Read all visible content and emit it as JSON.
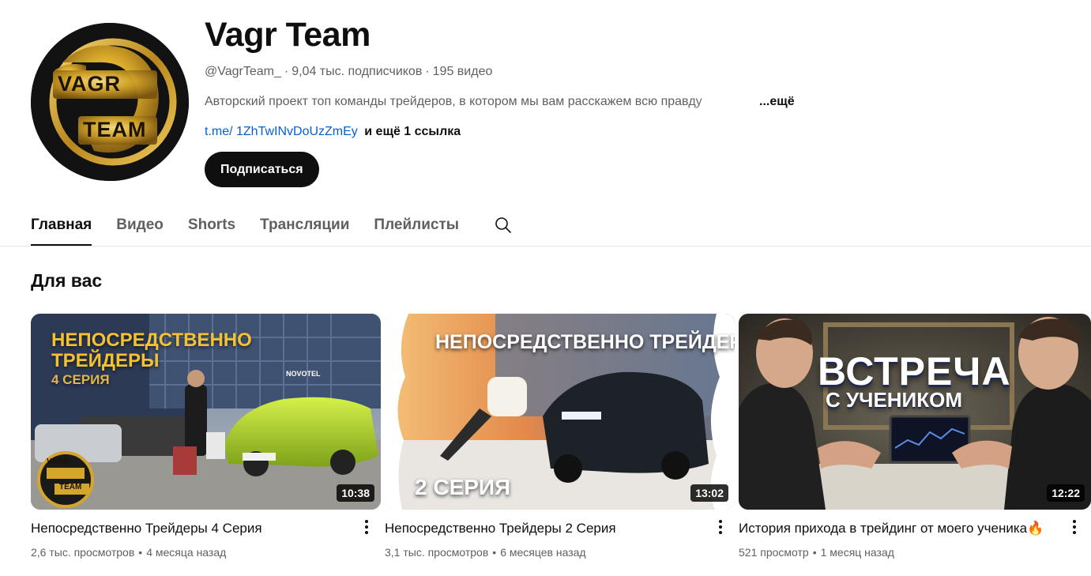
{
  "channel": {
    "title": "Vagr Team",
    "handle": "@VagrTeam_",
    "subscribers": "9,04 тыс. подписчиков",
    "video_count": "195 видео",
    "description": "Авторский проект топ команды трейдеров, в котором мы вам расскажем всю правду",
    "description_more": "...ещё",
    "link_text": "t.me/ 1ZhTwINvDoUzZmEy",
    "more_links": "и ещё 1 ссылка",
    "subscribe_label": "Подписаться",
    "avatar_logo": {
      "line1": "VAGR",
      "line2": "TEAM"
    }
  },
  "tabs": [
    {
      "label": "Главная",
      "active": true
    },
    {
      "label": "Видео",
      "active": false
    },
    {
      "label": "Shorts",
      "active": false
    },
    {
      "label": "Трансляции",
      "active": false
    },
    {
      "label": "Плейлисты",
      "active": false
    }
  ],
  "section": {
    "title": "Для вас"
  },
  "videos": [
    {
      "title": "Непосредственно Трейдеры 4 Серия",
      "views": "2,6 тыс. просмотров",
      "age": "4 месяца назад",
      "duration": "10:38",
      "thumb_caption_1": "НЕПОСРЕДСТВЕННО",
      "thumb_caption_2": "ТРЕЙДЕРЫ",
      "thumb_caption_3": "4 СЕРИЯ",
      "thumb_sign": "NOVOTEL",
      "thumb_logo_1": "VAGR",
      "thumb_logo_2": "TEAM"
    },
    {
      "title": "Непосредственно Трейдеры 2 Серия",
      "views": "3,1 тыс. просмотров",
      "age": "6 месяцев назад",
      "duration": "13:02",
      "thumb_caption_1": "НЕПОСРЕДСТВЕННО ТРЕЙДЕРЫ",
      "thumb_caption_2": "2 СЕРИЯ"
    },
    {
      "title": "История прихода в трейдинг от моего ученика🔥",
      "views": "521 просмотр",
      "age": "1 месяц назад",
      "duration": "12:22",
      "thumb_caption_1": "ВСТРЕЧА",
      "thumb_caption_2": "С УЧЕНИКОМ"
    }
  ],
  "colors": {
    "accent_link": "#065fd4",
    "text_primary": "#0f0f0f",
    "text_secondary": "#606060",
    "gold": "#d4a62a"
  }
}
